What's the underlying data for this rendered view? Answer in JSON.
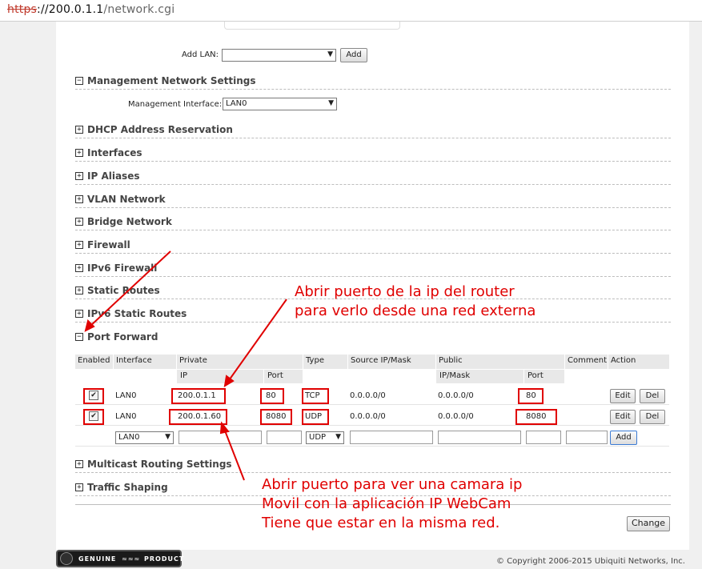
{
  "browser": {
    "url_proto": "https",
    "url_host": "://200.0.1.1",
    "url_path": "/network.cgi"
  },
  "add_lan": {
    "label": "Add LAN:",
    "button": "Add"
  },
  "management": {
    "section": "Management Network Settings",
    "interface_label": "Management Interface:",
    "interface_value": "LAN0"
  },
  "sections": {
    "dhcp": "DHCP Address Reservation",
    "interfaces": "Interfaces",
    "ip_aliases": "IP Aliases",
    "vlan": "VLAN Network",
    "bridge": "Bridge Network",
    "firewall": "Firewall",
    "ipv6_firewall": "IPv6 Firewall",
    "static_routes": "Static Routes",
    "ipv6_static_routes": "IPv6 Static Routes",
    "port_forward": "Port Forward",
    "multicast": "Multicast Routing Settings",
    "traffic": "Traffic Shaping"
  },
  "table": {
    "headers": {
      "enabled": "Enabled",
      "interface": "Interface",
      "private": "Private",
      "type": "Type",
      "source": "Source IP/Mask",
      "public": "Public",
      "comment": "Comment",
      "action": "Action",
      "ip": "IP",
      "port": "Port",
      "ipmask": "IP/Mask",
      "pport": "Port"
    },
    "rows": [
      {
        "check": "✔",
        "interface": "LAN0",
        "ip": "200.0.1.1",
        "port": "80",
        "type": "TCP",
        "source": "0.0.0.0/0",
        "public": "0.0.0.0/0",
        "pport": "80",
        "edit": "Edit",
        "del": "Del"
      },
      {
        "check": "✔",
        "interface": "LAN0",
        "ip": "200.0.1.60",
        "port": "8080",
        "type": "UDP",
        "source": "0.0.0.0/0",
        "public": "0.0.0.0/0",
        "pport": "8080",
        "edit": "Edit",
        "del": "Del"
      }
    ],
    "new_row": {
      "interface": "LAN0",
      "type": "UDP",
      "add": "Add"
    }
  },
  "change_button": "Change",
  "badge": {
    "t1": "GENUINE",
    "t2": "PRODUCT"
  },
  "copyright": "© Copyright 2006-2015 Ubiquiti Networks, Inc.",
  "annotations": {
    "note1_line1": "Abrir puerto de la ip del router",
    "note1_line2": "para verlo desde una red externa",
    "note2_line1": "Abrir puerto para ver una camara ip",
    "note2_line2": "Movil con la aplicación IP WebCam",
    "note2_line3": "Tiene que estar en la misma red.",
    "color": "#e00000"
  }
}
